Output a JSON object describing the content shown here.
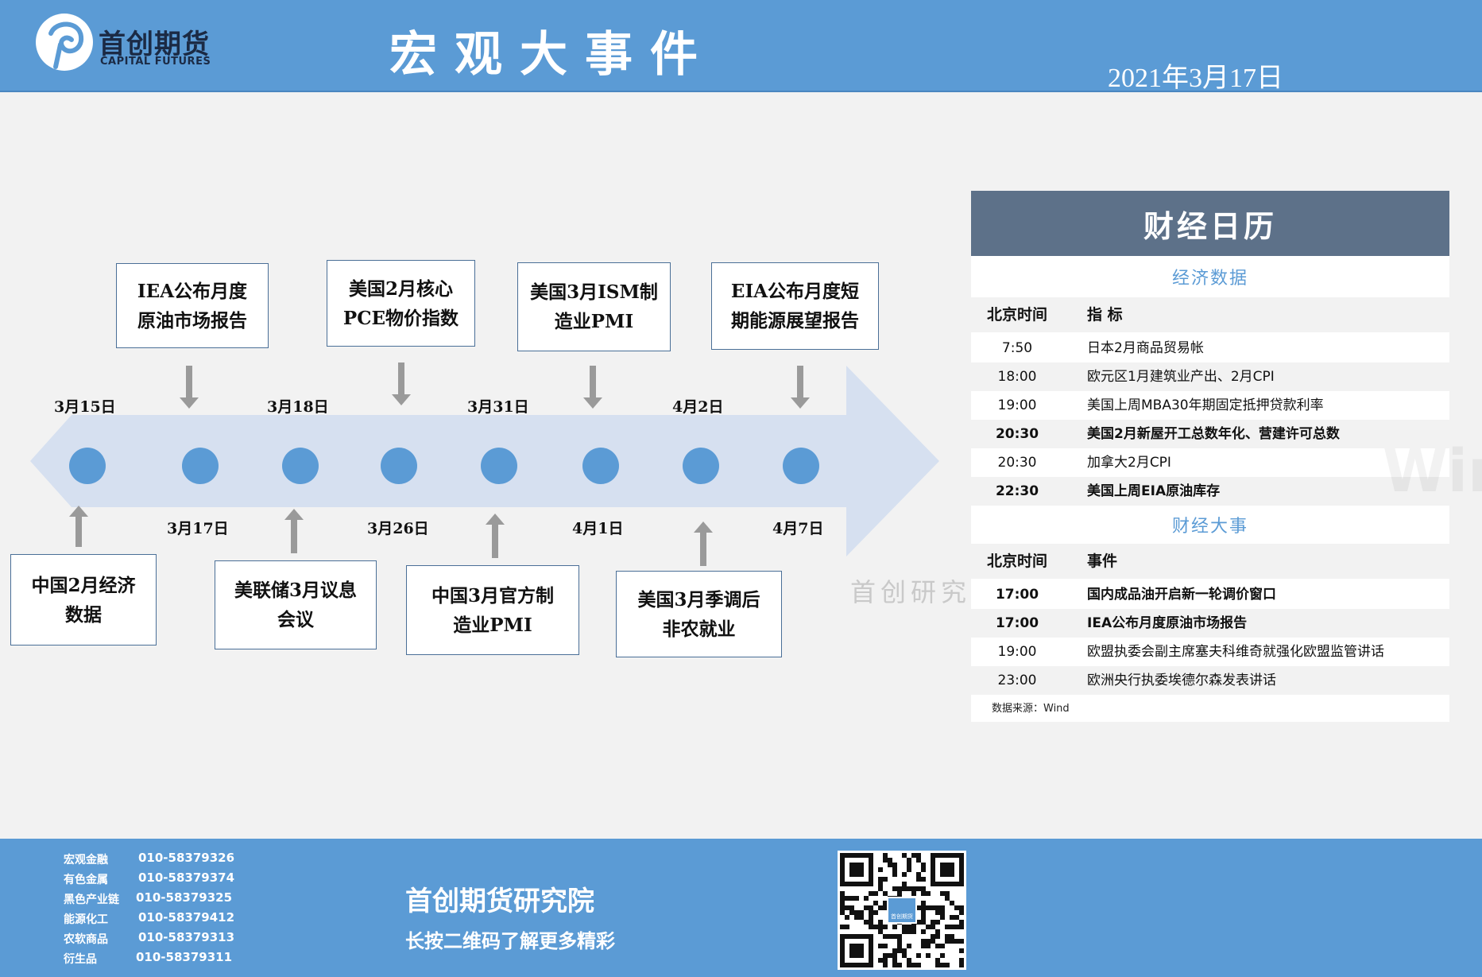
{
  "header": {
    "logo_cn": "首创期货",
    "logo_en": "CAPITAL FUTURES",
    "title": "宏观大事件",
    "date": "2021年3月17日"
  },
  "timeline": {
    "upper_dates": [
      "3月15日",
      "3月18日",
      "3月31日",
      "4月2日"
    ],
    "lower_dates": [
      "3月17日",
      "3月26日",
      "4月1日",
      "4月7日"
    ],
    "upper_events": [
      {
        "line1": "IEA公布月度",
        "line2": "原油市场报告"
      },
      {
        "line1": "美国2月核心",
        "line2": "PCE物价指数"
      },
      {
        "line1": "美国3月ISM制",
        "line2": "造业PMI"
      },
      {
        "line1": "EIA公布月度短",
        "line2": "期能源展望报告"
      }
    ],
    "lower_events": [
      {
        "line1": "中国2月经济",
        "line2": "数据"
      },
      {
        "line1": "美联储3月议息",
        "line2": "会议"
      },
      {
        "line1": "中国3月官方制",
        "line2": "造业PMI"
      },
      {
        "line1": "美国3月季调后",
        "line2": "非农就业"
      }
    ]
  },
  "calendar": {
    "title": "财经日历",
    "econ_section": "经济数据",
    "econ_header": {
      "time": "北京时间",
      "item": "指  标"
    },
    "econ_rows": [
      {
        "time": "7:50",
        "item": "日本2月商品贸易帐"
      },
      {
        "time": "18:00",
        "item": "欧元区1月建筑业产出、2月CPI"
      },
      {
        "time": "19:00",
        "item": "美国上周MBA30年期固定抵押贷款利率"
      },
      {
        "time": "20:30",
        "item": "美国2月新屋开工总数年化、营建许可总数"
      },
      {
        "time": "20:30",
        "item": "加拿大2月CPI"
      },
      {
        "time": "22:30",
        "item": "美国上周EIA原油库存"
      }
    ],
    "finance_section": "财经大事",
    "finance_header": {
      "time": "北京时间",
      "item": "事件"
    },
    "finance_rows": [
      {
        "time": "17:00",
        "item": "国内成品油开启新一轮调价窗口"
      },
      {
        "time": "17:00",
        "item": "IEA公布月度原油市场报告"
      },
      {
        "time": "19:00",
        "item": "欧盟执委会副主席塞夫科维奇就强化欧盟监管讲话"
      },
      {
        "time": "23:00",
        "item": "欧洲央行执委埃德尔森发表讲话"
      }
    ],
    "source": "数据来源：Wind"
  },
  "watermark": "首创研究",
  "watermark_logo": "Win.d",
  "footer": {
    "contacts": [
      {
        "name": "宏观金融",
        "phone": "010-58379326"
      },
      {
        "name": "有色金属",
        "phone": "010-58379374"
      },
      {
        "name": "黑色产业链",
        "phone": "010-58379325"
      },
      {
        "name": "能源化工",
        "phone": "010-58379412"
      },
      {
        "name": "农软商品",
        "phone": "010-58379313"
      },
      {
        "name": "衍生品",
        "phone": "010-58379311"
      }
    ],
    "institute": "首创期货研究院",
    "slogan": "长按二维码了解更多精彩",
    "qr_logo_text": "首创期货"
  },
  "colors": {
    "header_bg": "#5b9bd5",
    "arrow_fill": "#d6e0f0",
    "dot_fill": "#5b9bd5",
    "calendar_head": "#5d7189"
  }
}
